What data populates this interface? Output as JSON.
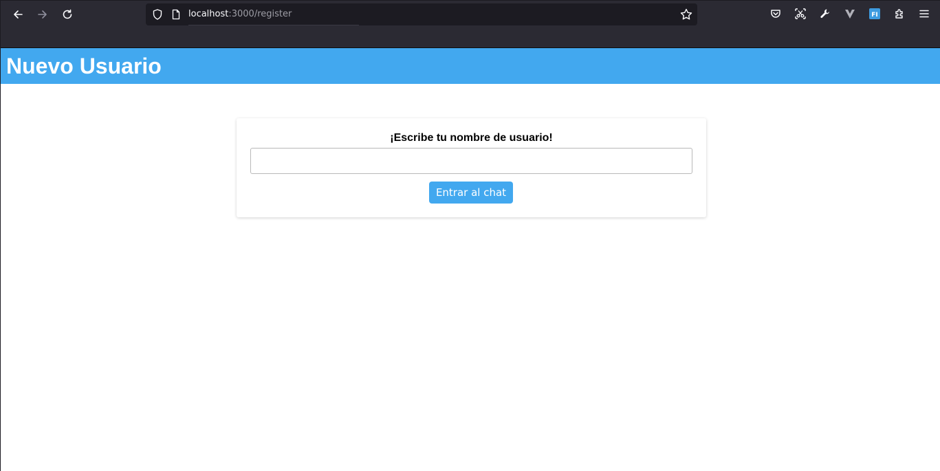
{
  "browser": {
    "url_host": "localhost",
    "url_path": ":3000/register",
    "icons": {
      "back": "back-arrow-icon",
      "forward": "forward-arrow-icon",
      "reload": "reload-icon",
      "shield": "tracking-shield-icon",
      "page": "page-info-icon",
      "bookmark": "bookmark-star-icon",
      "pocket": "pocket-icon",
      "screenshot": "screenshot-icon",
      "devtools": "wrench-icon",
      "extension_v": "v-extension-icon",
      "extension_fi": "fi-extension-icon",
      "extensions": "extensions-puzzle-icon",
      "menu": "hamburger-menu-icon"
    },
    "fi_label": "FI",
    "chrome_color": "#2b2a33",
    "urlbar_color": "#1c1b22"
  },
  "page": {
    "title": "Nuevo Usuario",
    "header_color": "#42a8ef",
    "form": {
      "label": "¡Escribe tu nombre de usuario!",
      "input_value": "",
      "button_label": "Entrar al chat",
      "button_color": "#42a8ef"
    }
  }
}
